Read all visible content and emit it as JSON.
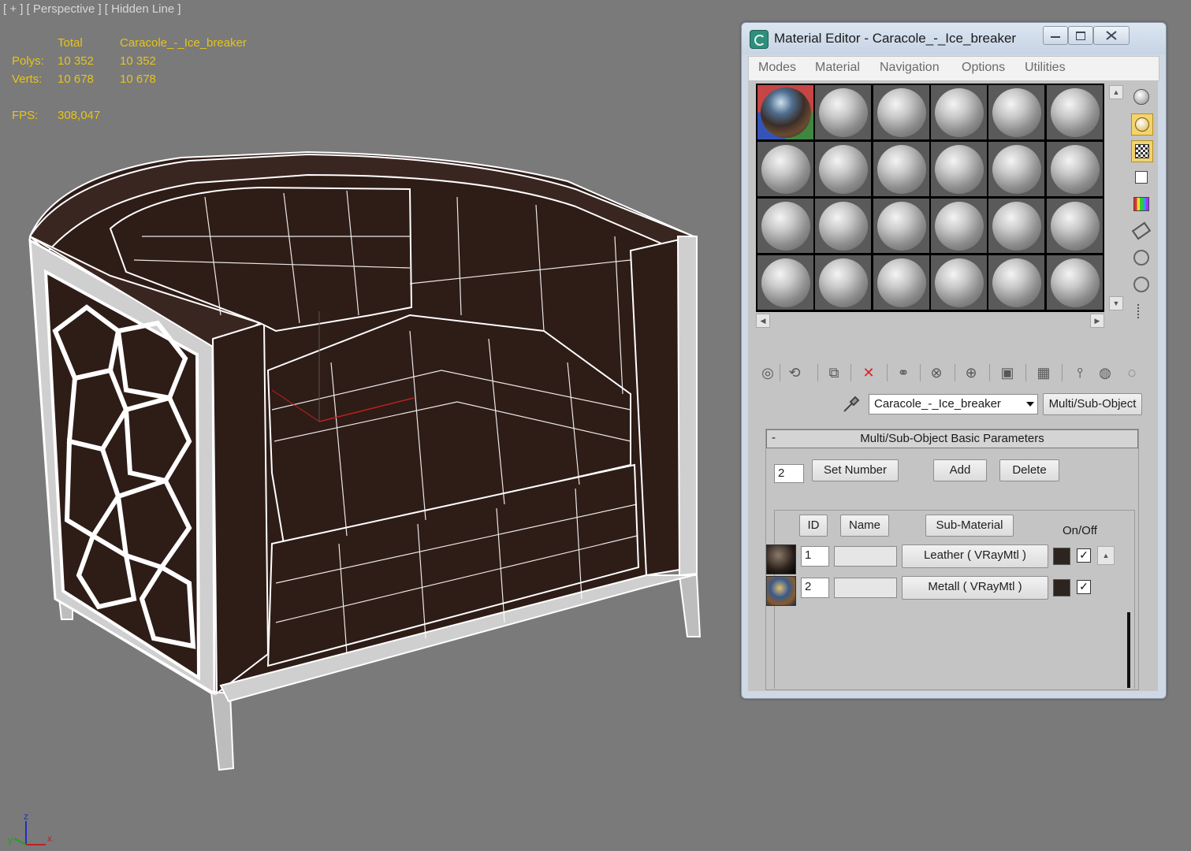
{
  "viewport": {
    "label": "[ + ] [ Perspective ] [ Hidden Line ]",
    "stats": {
      "header_total": "Total",
      "header_object": "Caracole_-_Ice_breaker",
      "polys_label": "Polys:",
      "polys_total": "10 352",
      "polys_object": "10 352",
      "verts_label": "Verts:",
      "verts_total": "10 678",
      "verts_object": "10 678",
      "fps_label": "FPS:",
      "fps_value": "308,047"
    },
    "axis": {
      "z": "z",
      "y": "y",
      "x": "x"
    }
  },
  "material_editor": {
    "title": "Material Editor - Caracole_-_Ice_breaker",
    "menu": [
      "Modes",
      "Material",
      "Navigation",
      "Options",
      "Utilities"
    ],
    "material_name": "Caracole_-_Ice_breaker",
    "material_type": "Multi/Sub-Object",
    "rollout_title": "Multi/Sub-Object Basic Parameters",
    "rollout_toggle": "-",
    "set_number_value": "2",
    "buttons": {
      "set_number": "Set Number",
      "add": "Add",
      "delete": "Delete"
    },
    "columns": {
      "id": "ID",
      "name": "Name",
      "sub_material": "Sub-Material",
      "on_off": "On/Off"
    },
    "rows": [
      {
        "id": "1",
        "name": "",
        "sub_material": "Leather  ( VRayMtl )",
        "checked": "✓"
      },
      {
        "id": "2",
        "name": "",
        "sub_material": "Metall  ( VRayMtl )",
        "checked": "✓"
      }
    ],
    "scroll_glyphs": {
      "up": "▲",
      "down": "▼",
      "left": "◀",
      "right": "▶"
    },
    "toolbar_glyphs": [
      "◎",
      "⟲",
      "⧉",
      "✕",
      "⚭",
      "⊗",
      "⊕",
      "▣",
      "▦",
      "⫯",
      "◍",
      "◌"
    ]
  },
  "colors": {
    "stats_yellow": "#e6c41a",
    "viewport_bg": "#7a7a7a",
    "chair_fabric": "#2e1c17",
    "window_bg": "#c4c4c4",
    "highlight": "#f2d36d"
  }
}
